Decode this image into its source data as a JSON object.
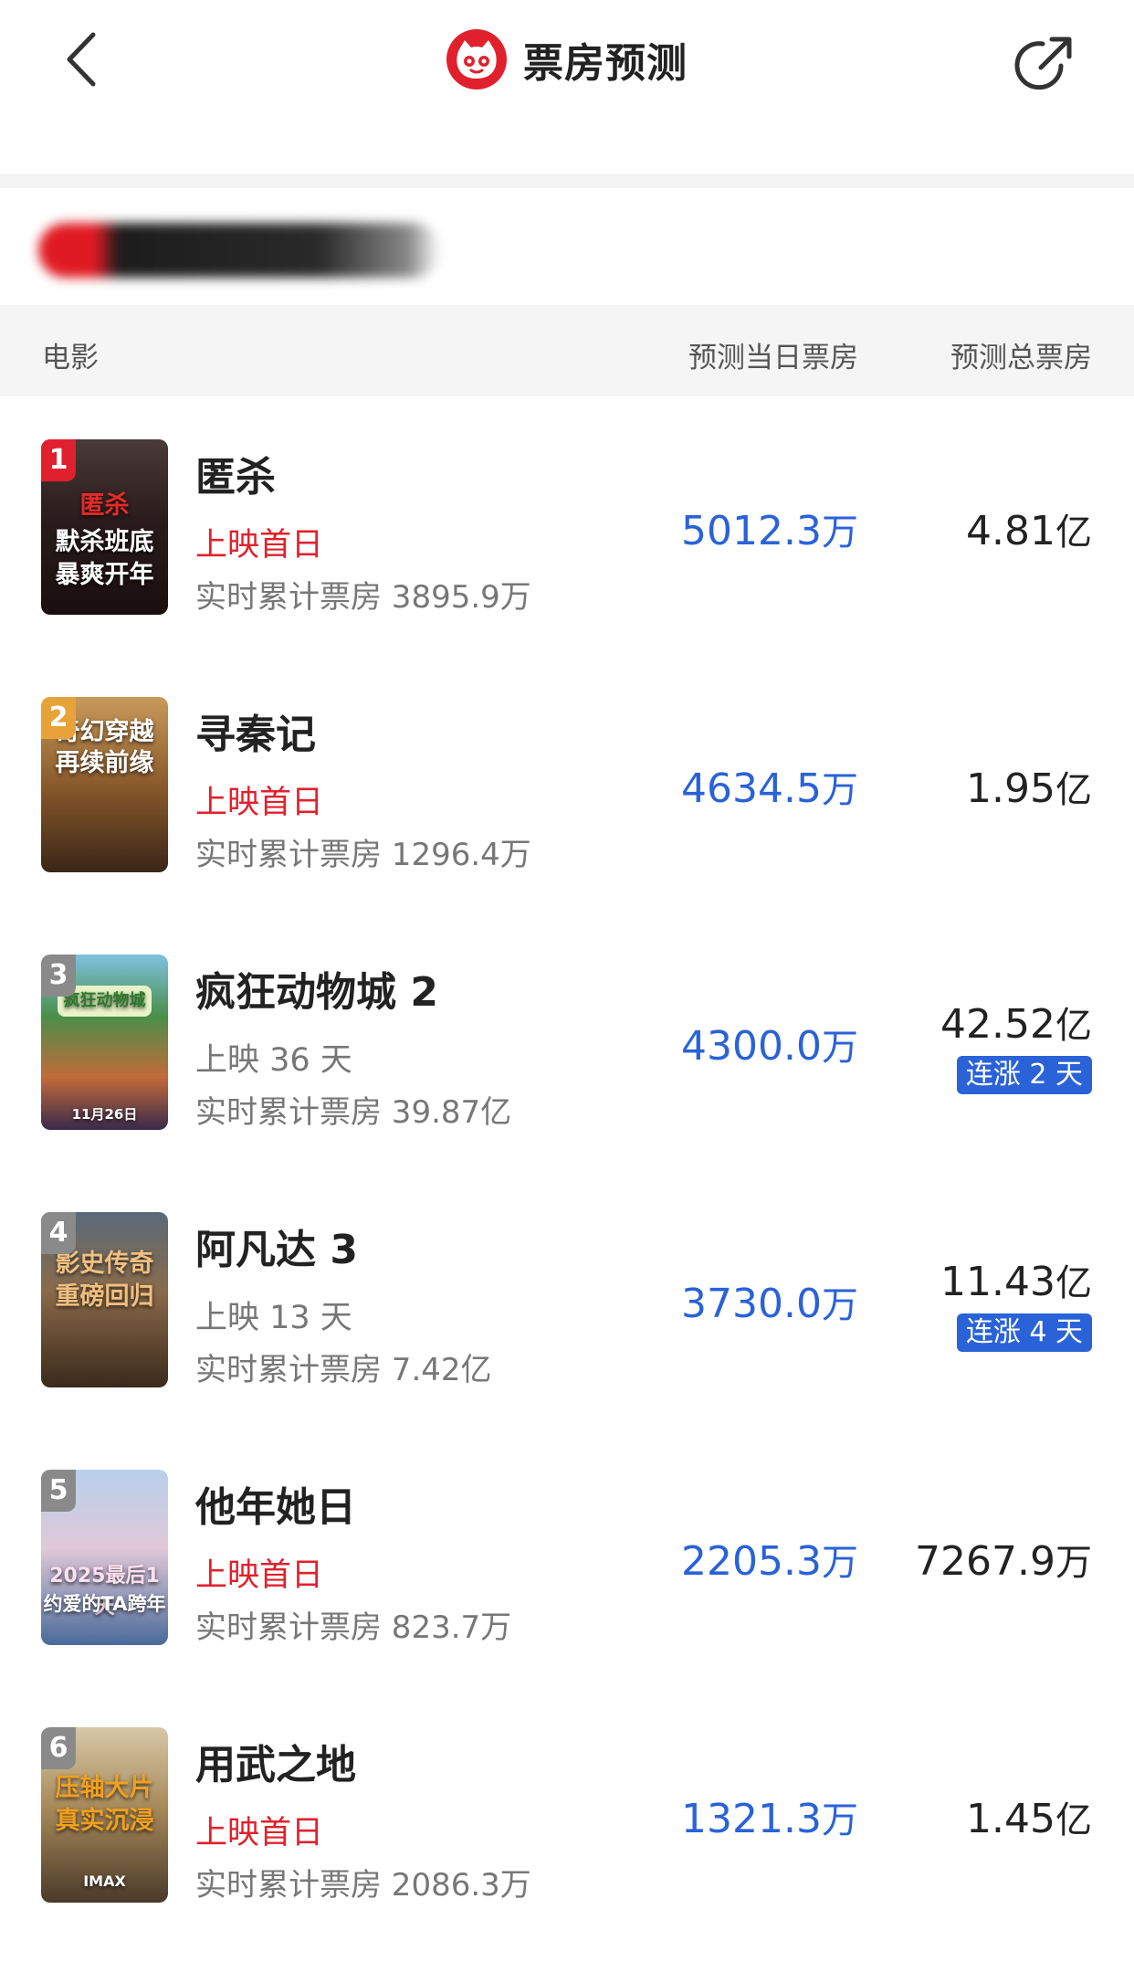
{
  "header": {
    "title": "票房预测",
    "back_icon": "chevron-left-icon",
    "share_icon": "share-icon",
    "logo_icon": "maoyan-cat-logo"
  },
  "table": {
    "col_movie": "电影",
    "col_daily": "预测当日票房",
    "col_total": "预测总票房"
  },
  "colors": {
    "accent_blue": "#2a62d8",
    "brand_red": "#e0212d",
    "rank_gold": "#e8a23a",
    "rank_gray": "#8a8a8a"
  },
  "movies": [
    {
      "rank": "1",
      "name": "匿杀",
      "status": "上映首日",
      "status_type": "red",
      "cumulative": "实时累计票房 3895.9万",
      "daily": "5012.3",
      "daily_unit": "万",
      "total": "4.81",
      "total_unit": "亿",
      "streak": "",
      "poster_lines": [
        "匿杀",
        "默杀班底",
        "暴爽开年"
      ]
    },
    {
      "rank": "2",
      "name": "寻秦记",
      "status": "上映首日",
      "status_type": "red",
      "cumulative": "实时累计票房 1296.4万",
      "daily": "4634.5",
      "daily_unit": "万",
      "total": "1.95",
      "total_unit": "亿",
      "streak": "",
      "poster_lines": [
        "奇幻穿越",
        "再续前缘"
      ]
    },
    {
      "rank": "3",
      "name": "疯狂动物城 2",
      "status": "上映 36 天",
      "status_type": "gray",
      "cumulative": "实时累计票房 39.87亿",
      "daily": "4300.0",
      "daily_unit": "万",
      "total": "42.52",
      "total_unit": "亿",
      "streak": "连涨 2 天",
      "poster_lines": [
        "疯狂动物城",
        "11月26日"
      ]
    },
    {
      "rank": "4",
      "name": "阿凡达 3",
      "status": "上映 13 天",
      "status_type": "gray",
      "cumulative": "实时累计票房 7.42亿",
      "daily": "3730.0",
      "daily_unit": "万",
      "total": "11.43",
      "total_unit": "亿",
      "streak": "连涨 4 天",
      "poster_lines": [
        "影史传奇",
        "重磅回归"
      ]
    },
    {
      "rank": "5",
      "name": "他年她日",
      "status": "上映首日",
      "status_type": "red",
      "cumulative": "实时累计票房 823.7万",
      "daily": "2205.3",
      "daily_unit": "万",
      "total": "7267.9",
      "total_unit": "万",
      "streak": "",
      "poster_lines": [
        "2025最后1天",
        "约爱的TA跨年"
      ]
    },
    {
      "rank": "6",
      "name": "用武之地",
      "status": "上映首日",
      "status_type": "red",
      "cumulative": "实时累计票房 2086.3万",
      "daily": "1321.3",
      "daily_unit": "万",
      "total": "1.45",
      "total_unit": "亿",
      "streak": "",
      "poster_lines": [
        "压轴大片",
        "真实沉浸",
        "IMAX"
      ]
    }
  ]
}
